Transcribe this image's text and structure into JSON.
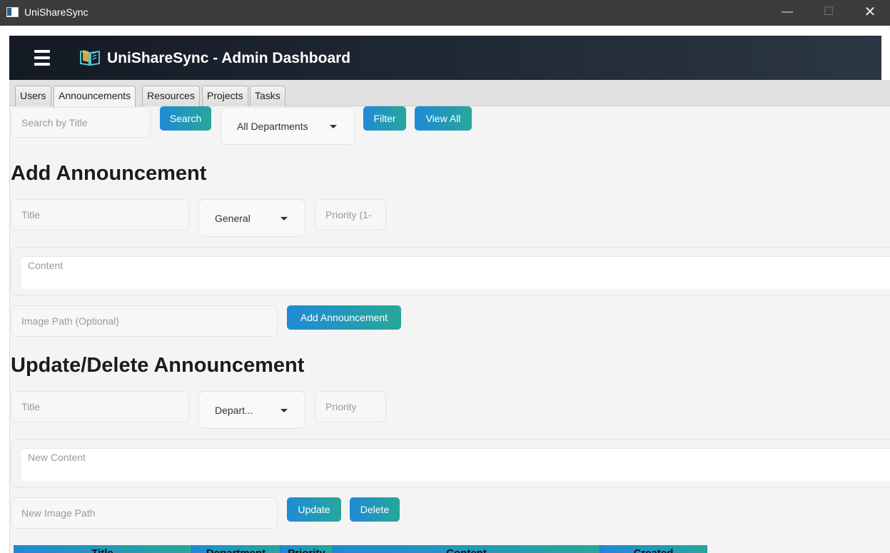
{
  "window": {
    "title": "UniShareSync",
    "minimize_glyph": "—",
    "maximize_glyph": "☐",
    "close_glyph": "✕"
  },
  "header": {
    "title": "UniShareSync - Admin Dashboard",
    "menu_icon": "hamburger-icon",
    "logo_icon": "book-icon"
  },
  "tabs": [
    {
      "label": "Users"
    },
    {
      "label": "Announcements",
      "active": true
    },
    {
      "label": "Resources"
    },
    {
      "label": "Projects"
    },
    {
      "label": "Tasks"
    }
  ],
  "search": {
    "placeholder": "Search by Title",
    "search_button": "Search",
    "department_filter": "All Departments",
    "filter_button": "Filter",
    "view_all_button": "View All"
  },
  "add_section": {
    "heading": "Add Announcement",
    "title_placeholder": "Title",
    "department_value": "General",
    "priority_placeholder": "Priority (1-",
    "content_placeholder": "Content",
    "image_placeholder": "Image Path (Optional)",
    "submit_button": "Add Announcement"
  },
  "update_section": {
    "heading": "Update/Delete Announcement",
    "title_placeholder": "Title",
    "department_value": "Depart...",
    "priority_placeholder": "Priority",
    "content_placeholder": "New Content",
    "image_placeholder": "New Image Path",
    "update_button": "Update",
    "delete_button": "Delete"
  },
  "table": {
    "columns": [
      "Title",
      "Department",
      "Priority",
      "Content",
      "Created"
    ]
  },
  "colors": {
    "button_gradient_start": "#1f8ad6",
    "button_gradient_end": "#27a79a",
    "header_bg": "#1a212c"
  }
}
